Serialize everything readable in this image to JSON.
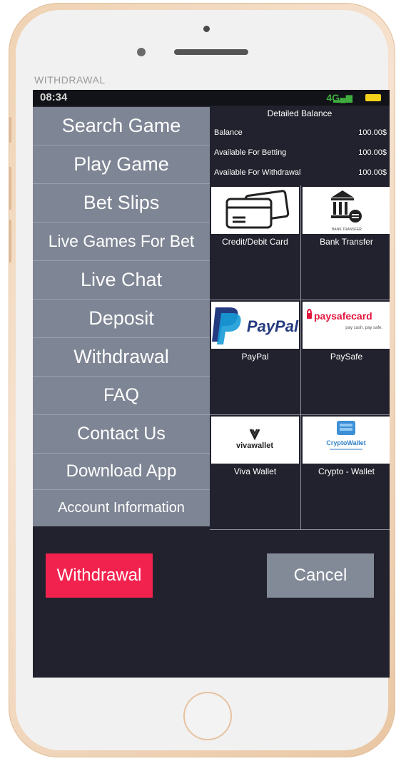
{
  "app": {
    "caption": "WITHDRAWAL"
  },
  "status_bar": {
    "time": "08:34",
    "network": "4G"
  },
  "menu": {
    "items": [
      {
        "label": "Search Game"
      },
      {
        "label": "Play Game"
      },
      {
        "label": "Bet Slips"
      },
      {
        "label": "Live Games For Bet"
      },
      {
        "label": "Live Chat"
      },
      {
        "label": "Deposit"
      },
      {
        "label": "Withdrawal"
      },
      {
        "label": "FAQ"
      },
      {
        "label": "Contact Us"
      },
      {
        "label": "Download App"
      },
      {
        "label": "Account Information"
      }
    ]
  },
  "balance": {
    "title": "Detailed Balance",
    "rows": [
      {
        "label": "Balance",
        "value": "100.00$"
      },
      {
        "label": "Available For Betting",
        "value": "100.00$"
      },
      {
        "label": "Available For Withdrawal",
        "value": "100.00$"
      }
    ]
  },
  "methods": [
    {
      "label": "Credit/Debit Card",
      "icon": "credit-card-icon"
    },
    {
      "label": "Bank Transfer",
      "icon": "bank-icon",
      "logo_text": "BANK TRANSFER"
    },
    {
      "label": "PayPal",
      "icon": "paypal-logo",
      "logo_text": "PayPal"
    },
    {
      "label": "PaySafe",
      "icon": "paysafe-logo",
      "logo_text": "paysafecard",
      "logo_tagline": "pay cash. pay safe."
    },
    {
      "label": "Viva Wallet",
      "icon": "viva-wallet-logo",
      "logo_text": "vivawallet"
    },
    {
      "label": "Crypto - Wallet",
      "icon": "crypto-wallet-logo",
      "logo_text": "CryptoWallet"
    }
  ],
  "actions": {
    "withdraw_label": "Withdrawal",
    "cancel_label": "Cancel"
  },
  "colors": {
    "screen_bg": "#22222e",
    "menu_bg": "#7e8594",
    "withdraw_button": "#f2224e",
    "cancel_button": "#828a98",
    "paypal_dark": "#253b80",
    "paypal_light": "#179bd7",
    "paysafe_red": "#e2163d"
  }
}
